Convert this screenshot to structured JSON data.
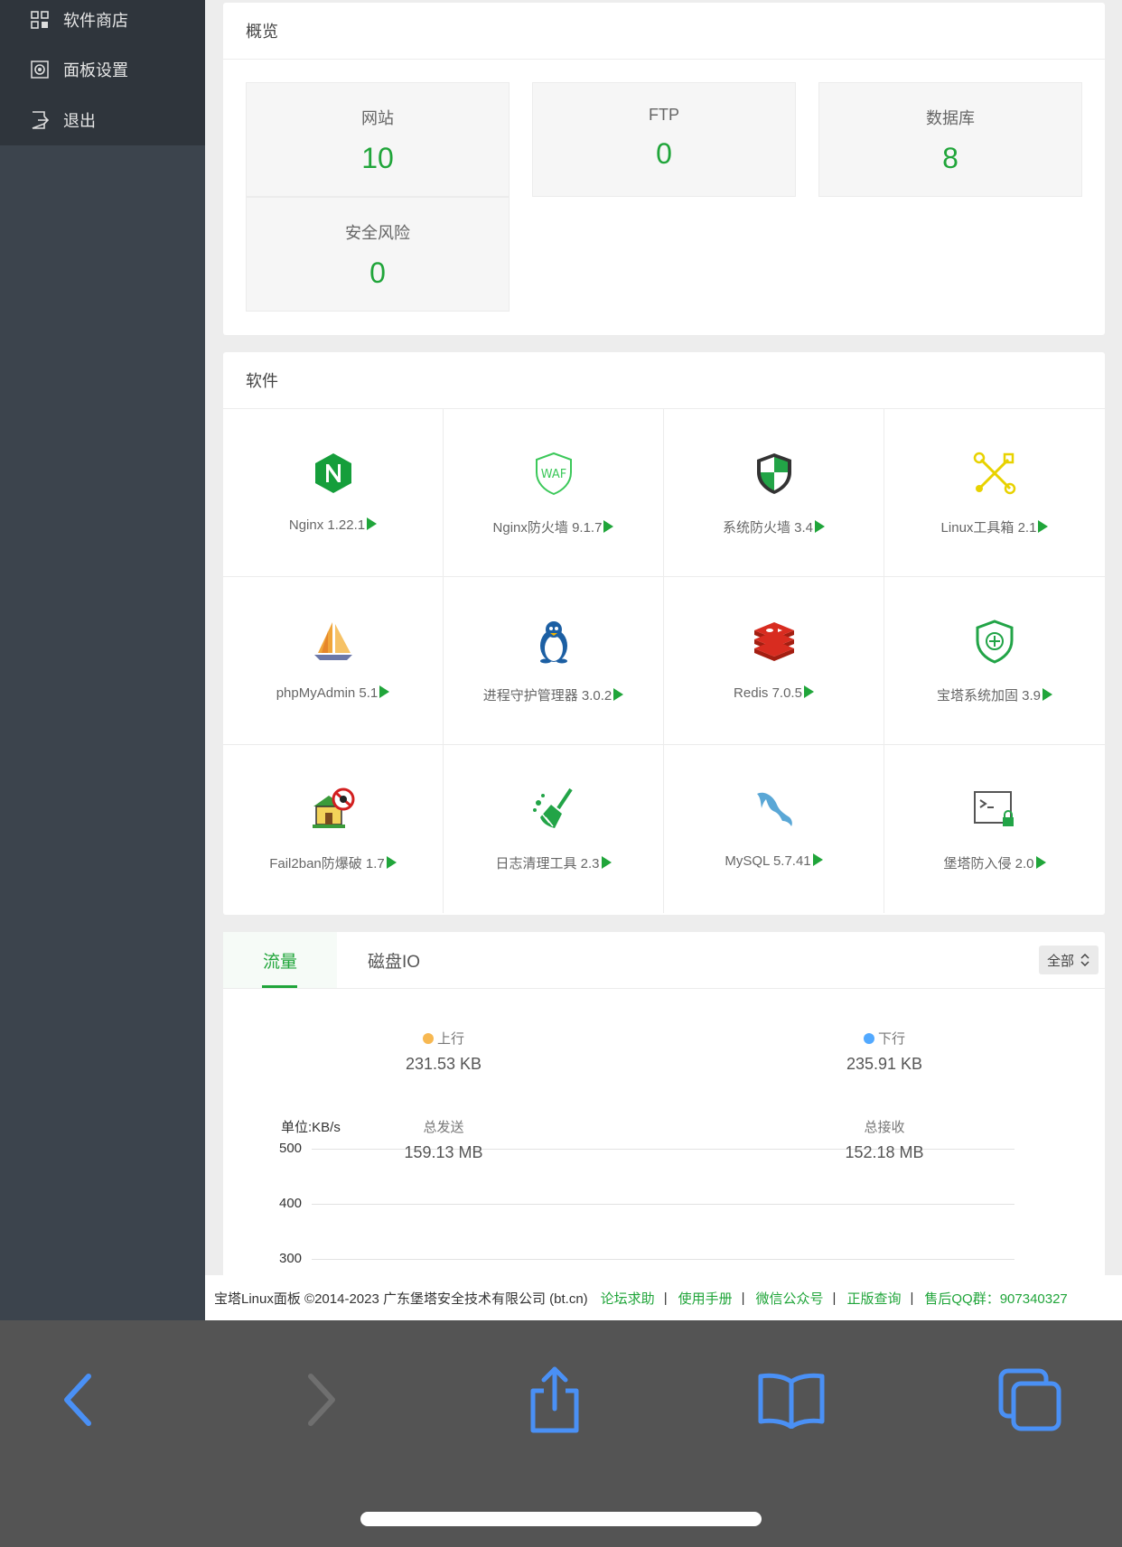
{
  "sidebar": {
    "items": [
      {
        "label": "软件商店",
        "icon": "grid-store-icon"
      },
      {
        "label": "面板设置",
        "icon": "gear-icon"
      },
      {
        "label": "退出",
        "icon": "logout-icon"
      }
    ]
  },
  "overview": {
    "title": "概览",
    "cards": [
      {
        "label": "网站",
        "value": "10"
      },
      {
        "label": "FTP",
        "value": "0"
      },
      {
        "label": "数据库",
        "value": "8"
      },
      {
        "label": "安全风险",
        "value": "0"
      }
    ]
  },
  "software": {
    "title": "软件",
    "items": [
      {
        "label": "Nginx 1.22.1",
        "icon": "nginx-icon"
      },
      {
        "label": "Nginx防火墙 9.1.7",
        "icon": "waf-shield-icon"
      },
      {
        "label": "系统防火墙 3.4",
        "icon": "firewall-shield-icon"
      },
      {
        "label": "Linux工具箱 2.1",
        "icon": "toolbox-icon"
      },
      {
        "label": "phpMyAdmin 5.1",
        "icon": "phpmyadmin-sailboat-icon"
      },
      {
        "label": "进程守护管理器 3.0.2",
        "icon": "penguin-icon"
      },
      {
        "label": "Redis 7.0.5",
        "icon": "redis-icon"
      },
      {
        "label": "宝塔系统加固 3.9",
        "icon": "shield-plus-icon"
      },
      {
        "label": "Fail2ban防爆破 1.7",
        "icon": "fail2ban-house-icon"
      },
      {
        "label": "日志清理工具 2.3",
        "icon": "broom-icon"
      },
      {
        "label": "MySQL 5.7.41",
        "icon": "mysql-dolphin-icon"
      },
      {
        "label": "堡塔防入侵 2.0",
        "icon": "terminal-lock-icon"
      }
    ]
  },
  "traffic": {
    "tabs": [
      "流量",
      "磁盘IO"
    ],
    "select_value": "全部",
    "up_label": "上行",
    "up_value": "231.53 KB",
    "down_label": "下行",
    "down_value": "235.91 KB",
    "total_sent_label": "总发送",
    "total_sent_value": "159.13 MB",
    "total_recv_label": "总接收",
    "total_recv_value": "152.18 MB",
    "up_color": "#f7b851",
    "down_color": "#52a9ff"
  },
  "chart_data": {
    "type": "line",
    "ylabel": "单位:KB/s",
    "yticks": [
      "500",
      "400",
      "300"
    ],
    "ylim_visible": [
      300,
      500
    ]
  },
  "footer": {
    "copyright": "宝塔Linux面板 ©2014-2023 广东堡塔安全技术有限公司 (bt.cn)",
    "links": [
      "论坛求助",
      "使用手册",
      "微信公众号",
      "正版查询",
      "售后QQ群：907340327"
    ],
    "separator": "|"
  },
  "colors": {
    "accent": "#20a53a",
    "sidebar_bg": "#3c444d",
    "ios_blue": "#4a90f5"
  }
}
